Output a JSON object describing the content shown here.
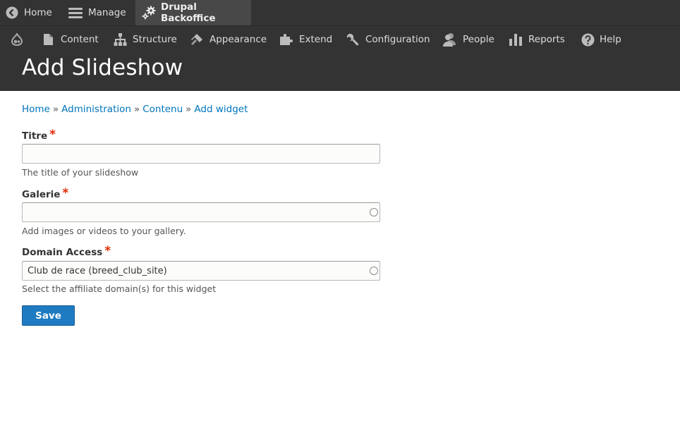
{
  "toolbar": {
    "home_label": "Home",
    "manage_label": "Manage",
    "site_label": "Drupal Backoffice"
  },
  "tray": {
    "items": [
      {
        "label": "Content",
        "icon": "content-icon"
      },
      {
        "label": "Structure",
        "icon": "structure-icon"
      },
      {
        "label": "Appearance",
        "icon": "appearance-icon"
      },
      {
        "label": "Extend",
        "icon": "extend-icon"
      },
      {
        "label": "Configuration",
        "icon": "configuration-icon"
      },
      {
        "label": "People",
        "icon": "people-icon"
      },
      {
        "label": "Reports",
        "icon": "reports-icon"
      },
      {
        "label": "Help",
        "icon": "help-icon"
      }
    ]
  },
  "page": {
    "title": "Add Slideshow"
  },
  "breadcrumb": {
    "items": [
      "Home",
      "Administration",
      "Contenu",
      "Add widget"
    ],
    "separator": "»"
  },
  "form": {
    "required_marker": "*",
    "titre": {
      "label": "Titre",
      "value": "",
      "description": "The title of your slideshow"
    },
    "galerie": {
      "label": "Galerie",
      "value": "",
      "description": "Add images or videos to your gallery."
    },
    "domain": {
      "label": "Domain Access",
      "value": "Club de race (breed_club_site)",
      "description": "Select the affiliate domain(s) for this widget"
    },
    "save_label": "Save"
  },
  "colors": {
    "toolbar_bg": "#333333",
    "active_tab_bg": "#484848",
    "link": "#0074bd",
    "required": "#e32700",
    "primary_button": "#1e7bc1"
  }
}
